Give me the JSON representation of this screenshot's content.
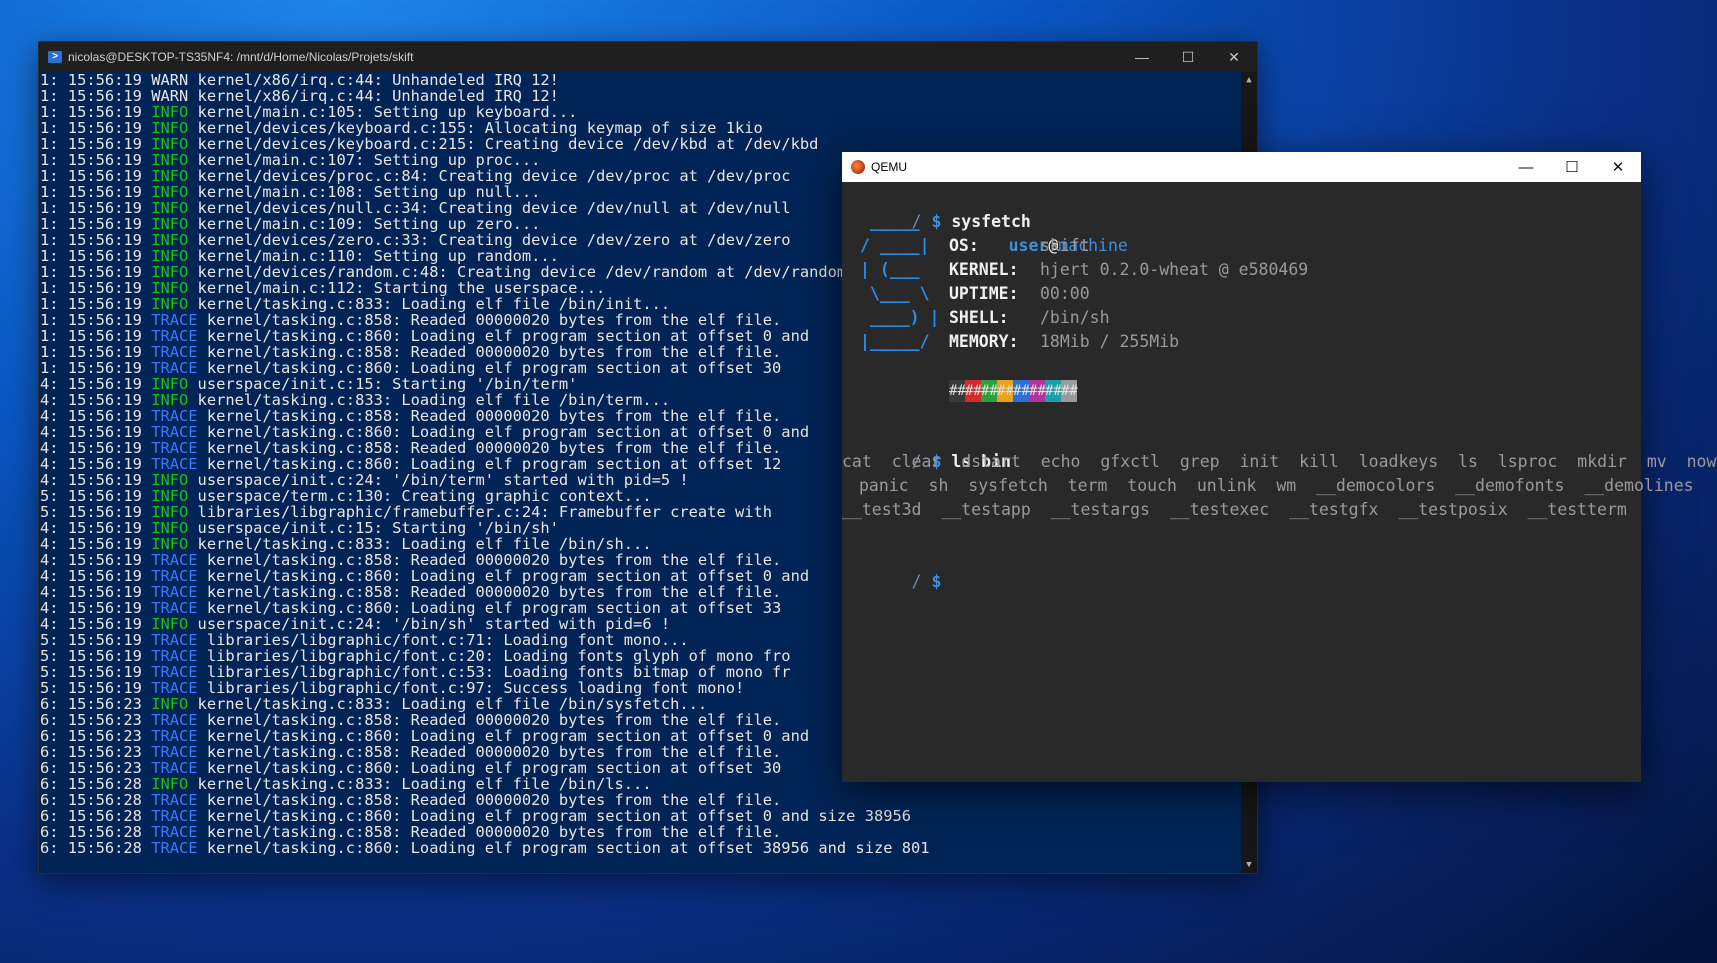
{
  "terminal": {
    "title": "nicolas@DESKTOP-TS35NF4: /mnt/d/Home/Nicolas/Projets/skift",
    "lines": [
      {
        "t": "1: 15:56:19 ",
        "lvl": "WARN",
        "msg": " kernel/x86/irq.c:44: Unhandeled IRQ 12!"
      },
      {
        "t": "1: 15:56:19 ",
        "lvl": "WARN",
        "msg": " kernel/x86/irq.c:44: Unhandeled IRQ 12!"
      },
      {
        "t": "1: 15:56:19 ",
        "lvl": "INFO",
        "msg": " kernel/main.c:105: Setting up keyboard..."
      },
      {
        "t": "1: 15:56:19 ",
        "lvl": "INFO",
        "msg": " kernel/devices/keyboard.c:155: Allocating keymap of size 1kio"
      },
      {
        "t": "1: 15:56:19 ",
        "lvl": "INFO",
        "msg": " kernel/devices/keyboard.c:215: Creating device /dev/kbd at /dev/kbd"
      },
      {
        "t": "1: 15:56:19 ",
        "lvl": "INFO",
        "msg": " kernel/main.c:107: Setting up proc..."
      },
      {
        "t": "1: 15:56:19 ",
        "lvl": "INFO",
        "msg": " kernel/devices/proc.c:84: Creating device /dev/proc at /dev/proc"
      },
      {
        "t": "1: 15:56:19 ",
        "lvl": "INFO",
        "msg": " kernel/main.c:108: Setting up null..."
      },
      {
        "t": "1: 15:56:19 ",
        "lvl": "INFO",
        "msg": " kernel/devices/null.c:34: Creating device /dev/null at /dev/null"
      },
      {
        "t": "1: 15:56:19 ",
        "lvl": "INFO",
        "msg": " kernel/main.c:109: Setting up zero..."
      },
      {
        "t": "1: 15:56:19 ",
        "lvl": "INFO",
        "msg": " kernel/devices/zero.c:33: Creating device /dev/zero at /dev/zero"
      },
      {
        "t": "1: 15:56:19 ",
        "lvl": "INFO",
        "msg": " kernel/main.c:110: Setting up random..."
      },
      {
        "t": "1: 15:56:19 ",
        "lvl": "INFO",
        "msg": " kernel/devices/random.c:48: Creating device /dev/random at /dev/random"
      },
      {
        "t": "1: 15:56:19 ",
        "lvl": "INFO",
        "msg": " kernel/main.c:112: Starting the userspace..."
      },
      {
        "t": "1: 15:56:19 ",
        "lvl": "INFO",
        "msg": " kernel/tasking.c:833: Loading elf file /bin/init..."
      },
      {
        "t": "1: 15:56:19 ",
        "lvl": "TRACE",
        "msg": " kernel/tasking.c:858: Readed 00000020 bytes from the elf file."
      },
      {
        "t": "1: 15:56:19 ",
        "lvl": "TRACE",
        "msg": " kernel/tasking.c:860: Loading elf program section at offset 0 and"
      },
      {
        "t": "1: 15:56:19 ",
        "lvl": "TRACE",
        "msg": " kernel/tasking.c:858: Readed 00000020 bytes from the elf file."
      },
      {
        "t": "1: 15:56:19 ",
        "lvl": "TRACE",
        "msg": " kernel/tasking.c:860: Loading elf program section at offset 30"
      },
      {
        "t": "4: 15:56:19 ",
        "lvl": "INFO",
        "msg": " userspace/init.c:15: Starting '/bin/term'"
      },
      {
        "t": "4: 15:56:19 ",
        "lvl": "INFO",
        "msg": " kernel/tasking.c:833: Loading elf file /bin/term..."
      },
      {
        "t": "4: 15:56:19 ",
        "lvl": "TRACE",
        "msg": " kernel/tasking.c:858: Readed 00000020 bytes from the elf file."
      },
      {
        "t": "4: 15:56:19 ",
        "lvl": "TRACE",
        "msg": " kernel/tasking.c:860: Loading elf program section at offset 0 and"
      },
      {
        "t": "4: 15:56:19 ",
        "lvl": "TRACE",
        "msg": " kernel/tasking.c:858: Readed 00000020 bytes from the elf file."
      },
      {
        "t": "4: 15:56:19 ",
        "lvl": "TRACE",
        "msg": " kernel/tasking.c:860: Loading elf program section at offset 12"
      },
      {
        "t": "4: 15:56:19 ",
        "lvl": "INFO",
        "msg": " userspace/init.c:24: '/bin/term' started with pid=5 !"
      },
      {
        "t": "5: 15:56:19 ",
        "lvl": "INFO",
        "msg": " userspace/term.c:130: Creating graphic context..."
      },
      {
        "t": "5: 15:56:19 ",
        "lvl": "INFO",
        "msg": " libraries/libgraphic/framebuffer.c:24: Framebuffer create with"
      },
      {
        "t": "4: 15:56:19 ",
        "lvl": "INFO",
        "msg": " userspace/init.c:15: Starting '/bin/sh'"
      },
      {
        "t": "4: 15:56:19 ",
        "lvl": "INFO",
        "msg": " kernel/tasking.c:833: Loading elf file /bin/sh..."
      },
      {
        "t": "4: 15:56:19 ",
        "lvl": "TRACE",
        "msg": " kernel/tasking.c:858: Readed 00000020 bytes from the elf file."
      },
      {
        "t": "4: 15:56:19 ",
        "lvl": "TRACE",
        "msg": " kernel/tasking.c:860: Loading elf program section at offset 0 and"
      },
      {
        "t": "4: 15:56:19 ",
        "lvl": "TRACE",
        "msg": " kernel/tasking.c:858: Readed 00000020 bytes from the elf file."
      },
      {
        "t": "4: 15:56:19 ",
        "lvl": "TRACE",
        "msg": " kernel/tasking.c:860: Loading elf program section at offset 33"
      },
      {
        "t": "4: 15:56:19 ",
        "lvl": "INFO",
        "msg": " userspace/init.c:24: '/bin/sh' started with pid=6 !"
      },
      {
        "t": "5: 15:56:19 ",
        "lvl": "TRACE",
        "msg": " libraries/libgraphic/font.c:71: Loading font mono..."
      },
      {
        "t": "5: 15:56:19 ",
        "lvl": "TRACE",
        "msg": " libraries/libgraphic/font.c:20: Loading fonts glyph of mono fro"
      },
      {
        "t": "5: 15:56:19 ",
        "lvl": "TRACE",
        "msg": " libraries/libgraphic/font.c:53: Loading fonts bitmap of mono fr"
      },
      {
        "t": "5: 15:56:19 ",
        "lvl": "TRACE",
        "msg": " libraries/libgraphic/font.c:97: Success loading font mono!"
      },
      {
        "t": "6: 15:56:23 ",
        "lvl": "INFO",
        "msg": " kernel/tasking.c:833: Loading elf file /bin/sysfetch..."
      },
      {
        "t": "6: 15:56:23 ",
        "lvl": "TRACE",
        "msg": " kernel/tasking.c:858: Readed 00000020 bytes from the elf file."
      },
      {
        "t": "6: 15:56:23 ",
        "lvl": "TRACE",
        "msg": " kernel/tasking.c:860: Loading elf program section at offset 0 and"
      },
      {
        "t": "6: 15:56:23 ",
        "lvl": "TRACE",
        "msg": " kernel/tasking.c:858: Readed 00000020 bytes from the elf file."
      },
      {
        "t": "6: 15:56:23 ",
        "lvl": "TRACE",
        "msg": " kernel/tasking.c:860: Loading elf program section at offset 30"
      },
      {
        "t": "6: 15:56:28 ",
        "lvl": "INFO",
        "msg": " kernel/tasking.c:833: Loading elf file /bin/ls..."
      },
      {
        "t": "6: 15:56:28 ",
        "lvl": "TRACE",
        "msg": " kernel/tasking.c:858: Readed 00000020 bytes from the elf file."
      },
      {
        "t": "6: 15:56:28 ",
        "lvl": "TRACE",
        "msg": " kernel/tasking.c:860: Loading elf program section at offset 0 and size 38956"
      },
      {
        "t": "6: 15:56:28 ",
        "lvl": "TRACE",
        "msg": " kernel/tasking.c:858: Readed 00000020 bytes from the elf file."
      },
      {
        "t": "6: 15:56:28 ",
        "lvl": "TRACE",
        "msg": " kernel/tasking.c:860: Loading elf program section at offset 38956 and size 801"
      }
    ]
  },
  "qemu": {
    "title": "QEMU",
    "prompt_dir": "/",
    "prompt_dollar": "$",
    "cmd1": "sysfetch",
    "logo": [
      " _____",
      "/ ____|",
      "| (___",
      " \\___ \\",
      " ____) |",
      "|_____/"
    ],
    "user": "user",
    "at": "@",
    "machine": "machine",
    "info": [
      {
        "label": "OS:",
        "value": "skift"
      },
      {
        "label": "KERNEL:",
        "value": "hjert 0.2.0-wheat @ e580469"
      },
      {
        "label": "UPTIME:",
        "value": "00:00"
      },
      {
        "label": "SHELL:",
        "value": "/bin/sh"
      },
      {
        "label": "MEMORY:",
        "value": "18Mib / 255Mib"
      }
    ],
    "swatch_text": "##",
    "colors": [
      "#3a3a3a",
      "#d12b2b",
      "#2e9e3e",
      "#e8a21b",
      "#2e6fd6",
      "#b0349c",
      "#1c9fa8",
      "#9a9a9a"
    ],
    "cmd2": "ls bin",
    "ls_rows": [
      [
        "cat",
        "clear",
        "dstart",
        "echo",
        "gfxctl",
        "grep",
        "init",
        "kill",
        "loadkeys",
        "ls",
        "lsproc",
        "mkdir",
        "mv",
        "now"
      ],
      [
        "panic",
        "sh",
        "sysfetch",
        "term",
        "touch",
        "unlink",
        "wm",
        "__democolors",
        "__demofonts",
        "__demolines"
      ],
      [
        "__test3d",
        "__testapp",
        "__testargs",
        "__testexec",
        "__testgfx",
        "__testposix",
        "__testterm"
      ]
    ]
  }
}
